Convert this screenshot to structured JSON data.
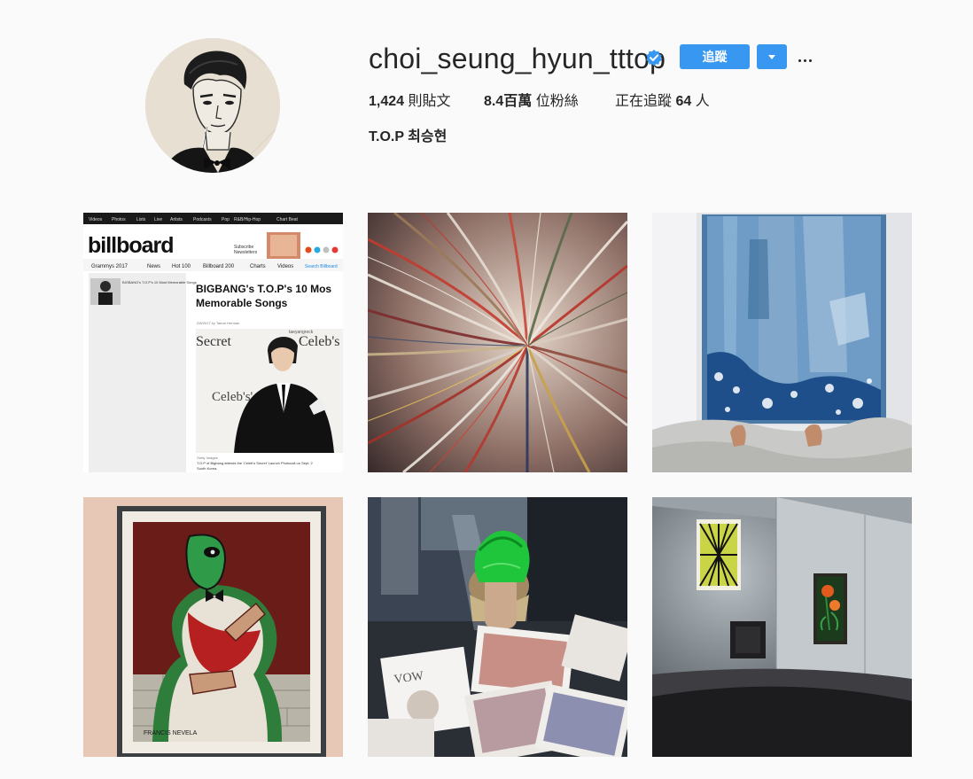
{
  "profile": {
    "username": "choi_seung_hyun_tttop",
    "verified": true,
    "follow_label": "追蹤",
    "full_name": "T.O.P 최승현",
    "stats": {
      "posts_count": "1,424",
      "posts_label": "則貼文",
      "followers_count": "8.4百萬",
      "followers_label": "位粉絲",
      "following_prefix": "正在追蹤",
      "following_count": "64",
      "following_suffix": "人"
    }
  },
  "colors": {
    "accent": "#3897f0",
    "background": "#fafafa",
    "text": "#262626"
  },
  "icons": {
    "verified": "verified-badge-icon",
    "dropdown": "caret-down-icon",
    "more": "more-options-icon"
  },
  "posts": [
    {
      "nav": [
        "Videos",
        "Photos",
        "Lists",
        "Live",
        "Artists",
        "Podcasts",
        "Pop",
        "R&B/Hip-Hop",
        "Chart Beat"
      ],
      "logo": "billboard",
      "subscribe": "Subscribe",
      "newsletters": "Newsletters",
      "tabs": [
        "Grammys 2017",
        "News",
        "Hot 100",
        "Billboard 200",
        "Charts",
        "Videos",
        "Search Billboard"
      ],
      "side_title": "BIGBANG's T.O.P's 10 Most Memorable Songs",
      "headline_1": "BIGBANG's T.O.P's 10 Mos",
      "headline_2": "Memorable Songs",
      "byline": "2/8/2017 by Tamar Herman",
      "backdrop_1": "Secret",
      "backdrop_2": "Celeb's",
      "backdrop_3": "Celeb's' Secret",
      "backdrop_4": "taeyangreck",
      "caption": "T.O.P of Bigbang attends the 'Celeb's Secret' Launch Photocall on Sept. 2",
      "caption_2": "South Korea."
    },
    {},
    {},
    {
      "signature": "FRANCIS NEVELA"
    },
    {
      "mag": "VOW"
    },
    {}
  ]
}
